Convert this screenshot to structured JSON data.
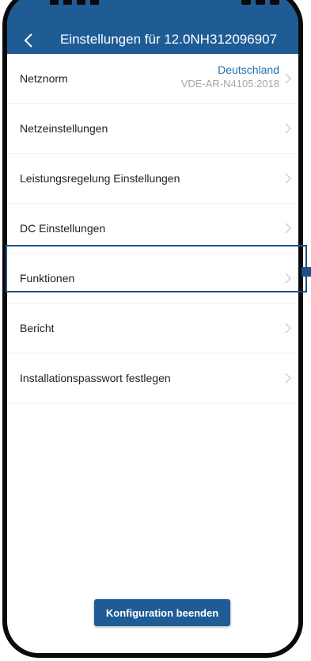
{
  "header": {
    "title": "Einstellungen für 12.0NH312096907",
    "back_icon": "chevron-left-icon"
  },
  "settings": {
    "items": [
      {
        "label": "Netznorm",
        "value_primary": "Deutschland",
        "value_secondary": "VDE-AR-N4105:2018"
      },
      {
        "label": "Netzeinstellungen"
      },
      {
        "label": "Leistungsregelung Einstellungen"
      },
      {
        "label": "DC Einstellungen"
      },
      {
        "label": "Funktionen",
        "highlighted": true
      },
      {
        "label": "Bericht"
      },
      {
        "label": "Installationspasswort festlegen"
      }
    ]
  },
  "footer": {
    "finish_label": "Konfiguration beenden"
  },
  "colors": {
    "header_bg": "#1f5c96",
    "accent_value": "#1f6fb3",
    "highlight_border": "#1f4f86"
  }
}
